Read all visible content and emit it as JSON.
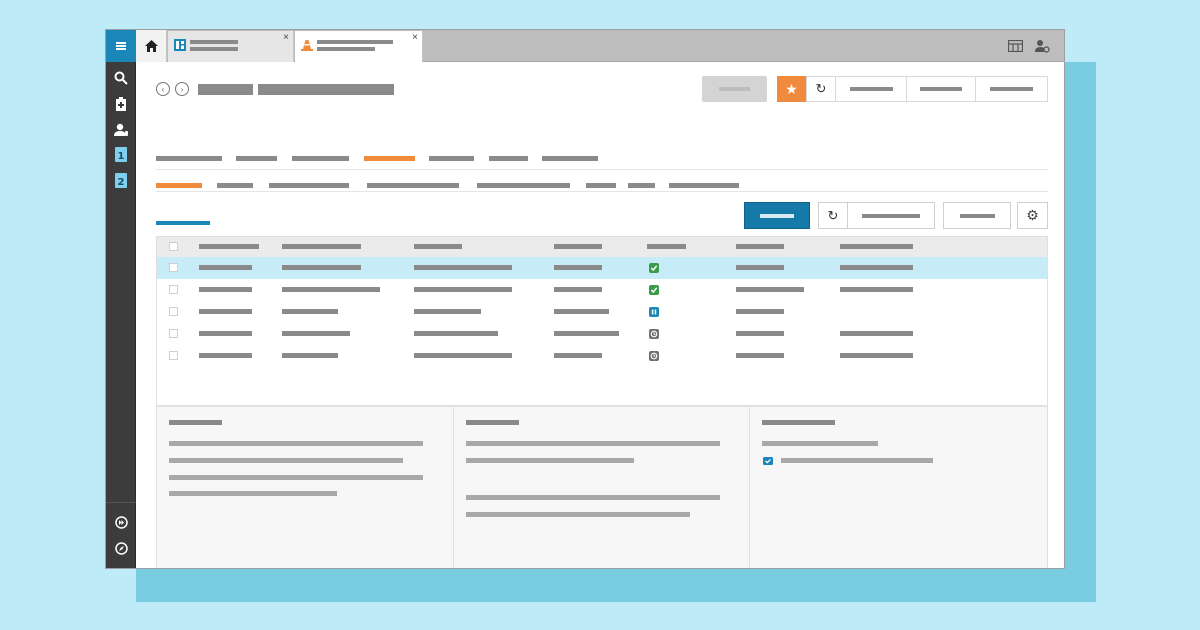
{
  "colors": {
    "background": "#bfeaf7",
    "shadow": "#7acde0",
    "rail": "#3c3c3c",
    "accent_blue": "#1b86b8",
    "accent_orange": "#f08a3c",
    "selected_row": "#c8ecf7",
    "status_green": "#3a9b4b",
    "status_blue": "#1b86b8",
    "status_gray": "#707070"
  },
  "rail": {
    "menu_icon": "hamburger-icon",
    "icons": [
      "search-icon",
      "clipboard-icon",
      "user-phone-icon",
      "badge-1-icon",
      "badge-2-icon"
    ],
    "bottom_icons": [
      "fast-forward-icon",
      "compass-icon"
    ],
    "badge_1": "1",
    "badge_2": "2"
  },
  "tabbar": {
    "home_icon": "home-icon",
    "tabs": [
      {
        "icon": "grid-icon",
        "close": "×"
      },
      {
        "icon": "cone-icon",
        "close": "×"
      }
    ],
    "right_icons": [
      "table-settings-icon",
      "user-settings-icon"
    ]
  },
  "header": {
    "back_icon": "‹",
    "forward_icon": "›",
    "star_icon": "★",
    "refresh_icon": "↻"
  },
  "toolbar": {
    "refresh_icon": "↻",
    "gear_icon": "⚙"
  },
  "table": {
    "selected_row": 1,
    "status_icons": [
      "check-green",
      "check-green",
      "pause-blue",
      "clock-gray",
      "clock-gray"
    ]
  },
  "details": {
    "check_icon": "✓"
  }
}
